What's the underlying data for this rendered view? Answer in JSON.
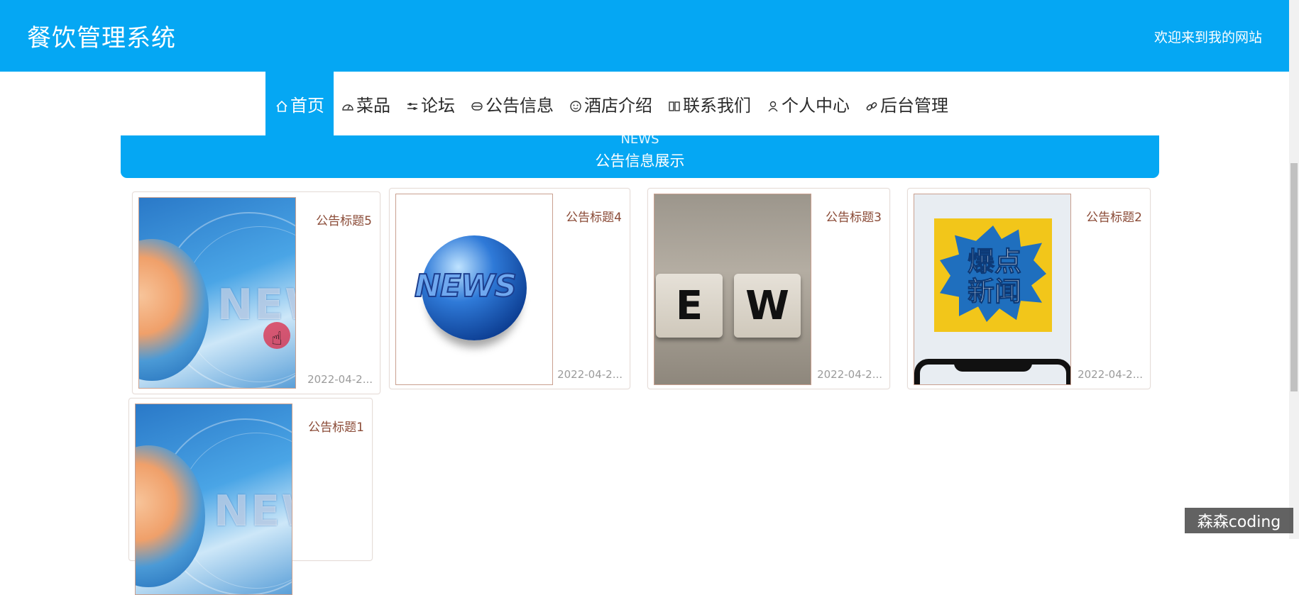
{
  "header": {
    "site_title": "餐饮管理系统",
    "welcome": "欢迎来到我的网站"
  },
  "nav": {
    "items": [
      {
        "label": "首页",
        "icon": "home-icon",
        "active": true
      },
      {
        "label": "菜品",
        "icon": "dashboard-icon"
      },
      {
        "label": "论坛",
        "icon": "sliders-icon"
      },
      {
        "label": "公告信息",
        "icon": "printer-icon"
      },
      {
        "label": "酒店介绍",
        "icon": "smile-icon"
      },
      {
        "label": "联系我们",
        "icon": "book-icon"
      },
      {
        "label": "个人中心",
        "icon": "user-icon"
      },
      {
        "label": "后台管理",
        "icon": "link-icon"
      }
    ]
  },
  "banner": {
    "en": "NEWS",
    "cn": "公告信息展示"
  },
  "cards": [
    {
      "title": "公告标题5",
      "date": "2022-04-2...",
      "image": "news-blue-globe"
    },
    {
      "title": "公告标题4",
      "date": "2022-04-2...",
      "image": "news-globe"
    },
    {
      "title": "公告标题3",
      "date": "2022-04-2...",
      "image": "dice-news"
    },
    {
      "title": "公告标题2",
      "date": "2022-04-2...",
      "image": "breaking-news-phone",
      "image_text": "爆点新闻",
      "dice_letters": [
        "E",
        "W"
      ]
    },
    {
      "title": "公告标题1",
      "date": "",
      "image": "news-blue-globe"
    }
  ],
  "watermark": "森森coding",
  "colors": {
    "primary": "#05a7f3",
    "title_text": "#8a4a36",
    "date_text": "#9b9b9b"
  }
}
